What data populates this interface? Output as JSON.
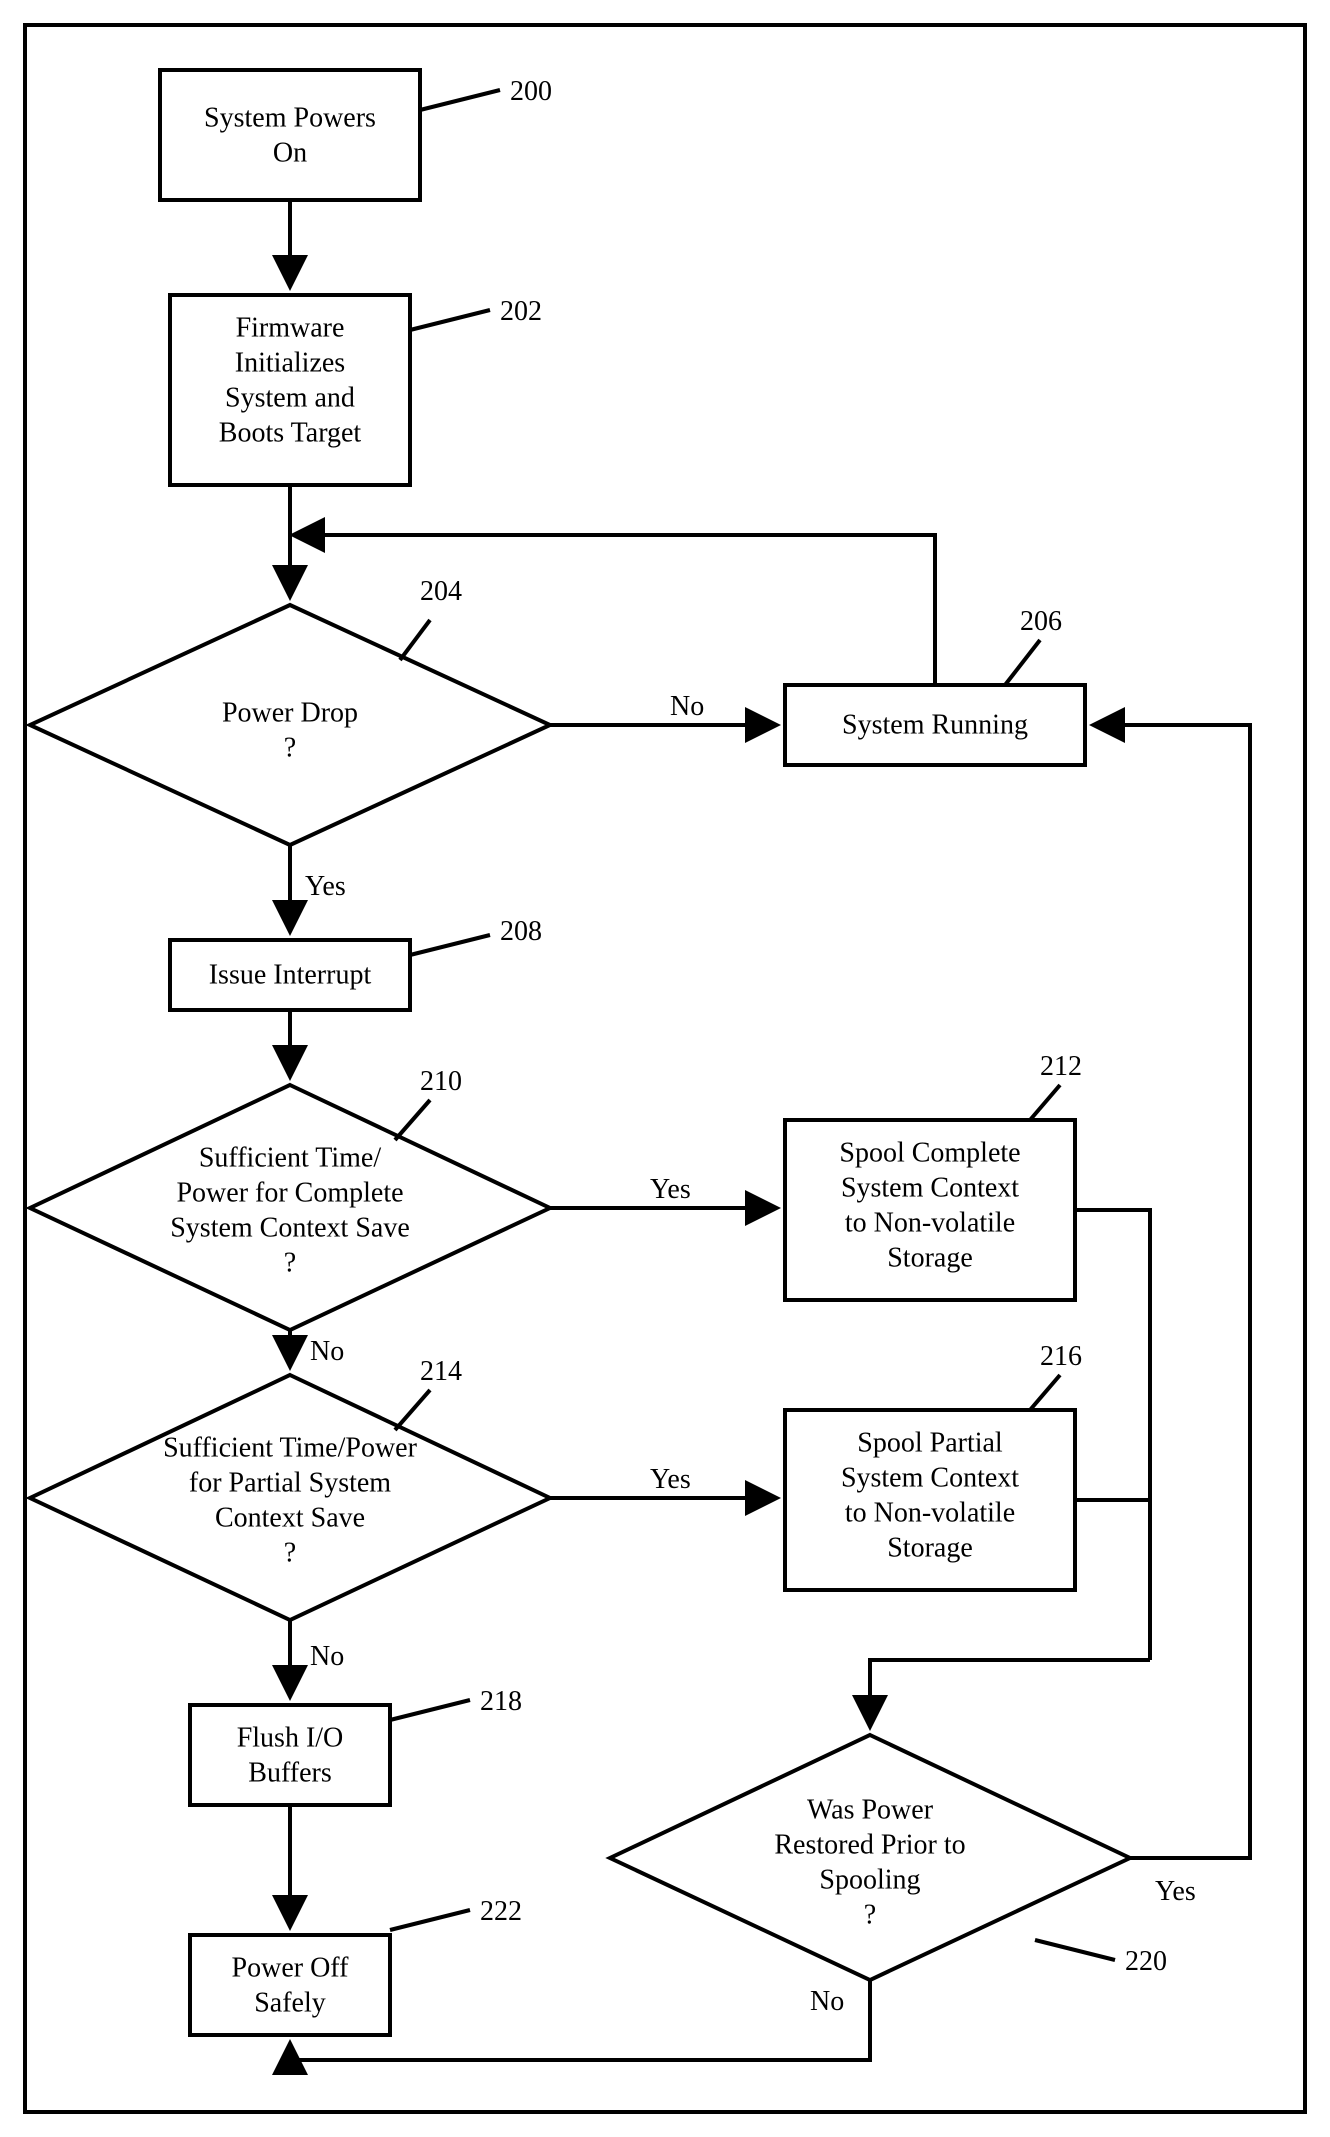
{
  "nodes": {
    "n200": {
      "ref": "200",
      "lines": [
        "System Powers",
        "On"
      ]
    },
    "n202": {
      "ref": "202",
      "lines": [
        "Firmware",
        "Initializes",
        "System and",
        "Boots Target"
      ]
    },
    "n204": {
      "ref": "204",
      "lines": [
        "Power Drop",
        "?"
      ]
    },
    "n206": {
      "ref": "206",
      "lines": [
        "System Running"
      ]
    },
    "n208": {
      "ref": "208",
      "lines": [
        "Issue Interrupt"
      ]
    },
    "n210": {
      "ref": "210",
      "lines": [
        "Sufficient Time/",
        "Power for Complete",
        "System Context Save",
        "?"
      ]
    },
    "n212": {
      "ref": "212",
      "lines": [
        "Spool Complete",
        "System Context",
        "to Non-volatile",
        "Storage"
      ]
    },
    "n214": {
      "ref": "214",
      "lines": [
        "Sufficient Time/Power",
        "for Partial System",
        "Context Save",
        "?"
      ]
    },
    "n216": {
      "ref": "216",
      "lines": [
        "Spool Partial",
        "System Context",
        "to Non-volatile",
        "Storage"
      ]
    },
    "n218": {
      "ref": "218",
      "lines": [
        "Flush I/O",
        "Buffers"
      ]
    },
    "n220": {
      "ref": "220",
      "lines": [
        "Was Power",
        "Restored Prior to",
        "Spooling",
        "?"
      ]
    },
    "n222": {
      "ref": "222",
      "lines": [
        "Power Off",
        "Safely"
      ]
    }
  },
  "edges": {
    "yes": "Yes",
    "no": "No"
  }
}
